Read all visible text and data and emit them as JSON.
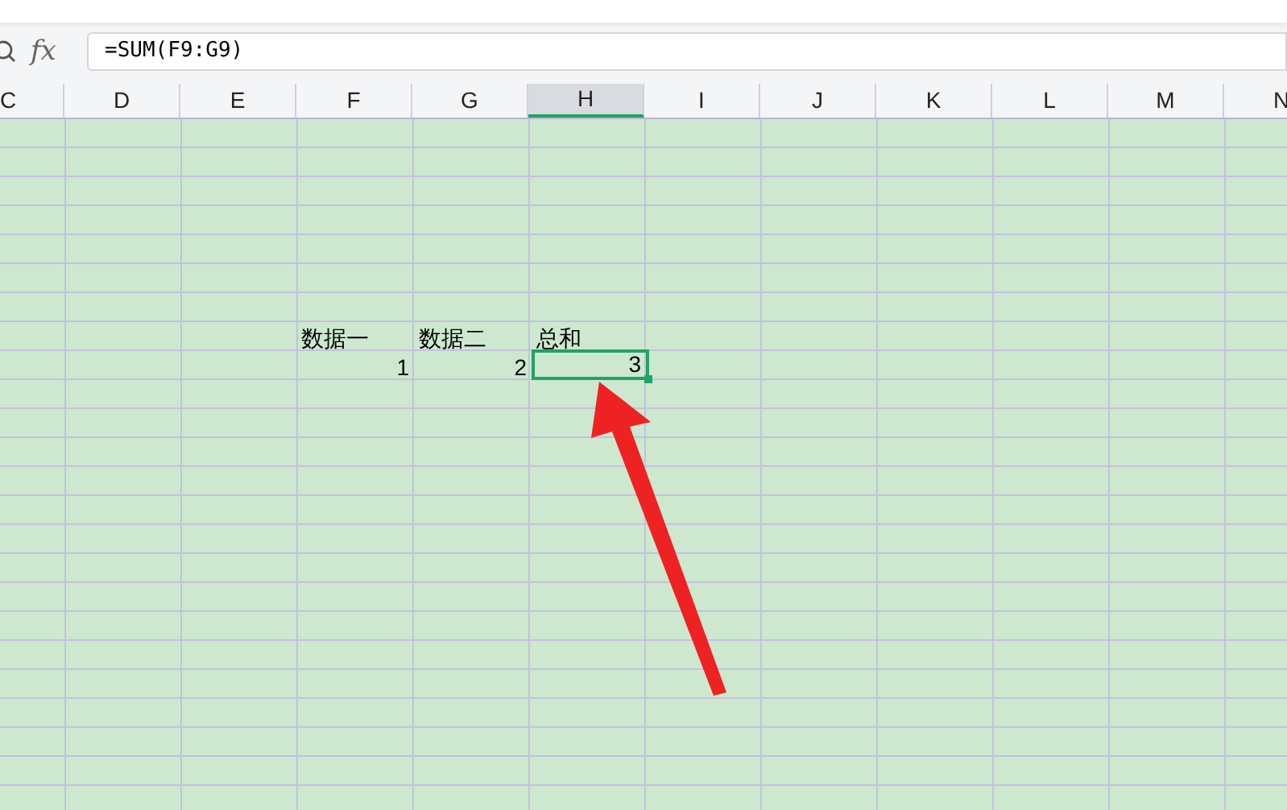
{
  "formula_bar": {
    "value": "=SUM(F9:G9)",
    "fx_label": "fx"
  },
  "columns": [
    {
      "label": "C",
      "selected": false
    },
    {
      "label": "D",
      "selected": false
    },
    {
      "label": "E",
      "selected": false
    },
    {
      "label": "F",
      "selected": false
    },
    {
      "label": "G",
      "selected": false
    },
    {
      "label": "H",
      "selected": true
    },
    {
      "label": "I",
      "selected": false
    },
    {
      "label": "J",
      "selected": false
    },
    {
      "label": "K",
      "selected": false
    },
    {
      "label": "L",
      "selected": false
    },
    {
      "label": "M",
      "selected": false
    },
    {
      "label": "N",
      "selected": false
    }
  ],
  "data_rows": [
    {
      "cells": [
        {
          "text": "数据一",
          "kind": "text",
          "selected": false
        },
        {
          "text": "数据二",
          "kind": "text",
          "selected": false
        },
        {
          "text": "总和",
          "kind": "text",
          "selected": false
        }
      ]
    },
    {
      "cells": [
        {
          "text": "1",
          "kind": "number",
          "selected": false
        },
        {
          "text": "2",
          "kind": "number",
          "selected": false
        },
        {
          "text": "3",
          "kind": "number",
          "selected": true
        }
      ]
    }
  ]
}
